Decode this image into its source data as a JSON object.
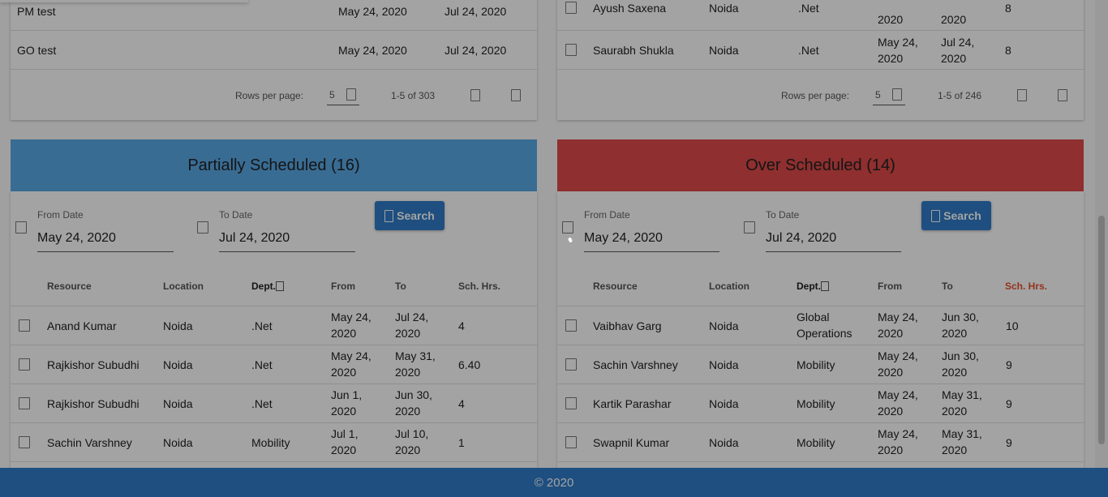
{
  "top_left": {
    "rows": [
      {
        "name": "PM test",
        "from": "May 24, 2020",
        "to": "Jul 24, 2020"
      },
      {
        "name": "GO test",
        "from": "May 24, 2020",
        "to": "Jul 24, 2020"
      }
    ],
    "pager": {
      "rows_label": "Rows per page:",
      "rows_value": "5",
      "range": "1-5 of 303"
    }
  },
  "top_right": {
    "rows": [
      {
        "resource": "Ayush Saxena",
        "location": "Noida",
        "dept": ".Net",
        "from": "2020",
        "to": "2020",
        "hrs": "8"
      },
      {
        "resource": "Saurabh Shukla",
        "location": "Noida",
        "dept": ".Net",
        "from_1": "May 24,",
        "from_2": "2020",
        "to_1": "Jul 24,",
        "to_2": "2020",
        "hrs": "8"
      }
    ],
    "pager": {
      "rows_label": "Rows per page:",
      "rows_value": "5",
      "range": "1-5 of 246"
    }
  },
  "partial": {
    "title": "Partially Scheduled (16)",
    "color": "#5aa9e6",
    "from_label": "From Date",
    "from_value": "May 24, 2020",
    "to_label": "To Date",
    "to_value": "Jul 24, 2020",
    "search_label": "Search",
    "headers": {
      "resource": "Resource",
      "location": "Location",
      "dept": "Dept.",
      "from": "From",
      "to": "To",
      "hrs": "Sch. Hrs."
    },
    "rows": [
      {
        "resource": "Anand Kumar",
        "location": "Noida",
        "dept": ".Net",
        "from_1": "May 24,",
        "from_2": "2020",
        "to_1": "Jul 24,",
        "to_2": "2020",
        "hrs": "4"
      },
      {
        "resource": "Rajkishor Subudhi",
        "location": "Noida",
        "dept": ".Net",
        "from_1": "May 24,",
        "from_2": "2020",
        "to_1": "May 31,",
        "to_2": "2020",
        "hrs": "6.40"
      },
      {
        "resource": "Rajkishor Subudhi",
        "location": "Noida",
        "dept": ".Net",
        "from_1": "Jun 1,",
        "from_2": "2020",
        "to_1": "Jun 30,",
        "to_2": "2020",
        "hrs": "4"
      },
      {
        "resource": "Sachin Varshney",
        "location": "Noida",
        "dept": "Mobility",
        "from_1": "Jul 1,",
        "from_2": "2020",
        "to_1": "Jul 10,",
        "to_2": "2020",
        "hrs": "1"
      }
    ]
  },
  "over": {
    "title": "Over Scheduled (14)",
    "color": "#e04a4a",
    "from_label": "From Date",
    "from_value": "May 24, 2020",
    "to_label": "To Date",
    "to_value": "Jul 24, 2020",
    "search_label": "Search",
    "headers": {
      "resource": "Resource",
      "location": "Location",
      "dept": "Dept.",
      "from": "From",
      "to": "To",
      "hrs": "Sch. Hrs."
    },
    "rows": [
      {
        "resource": "Vaibhav Garg",
        "location": "Noida",
        "dept_1": "Global",
        "dept_2": "Operations",
        "from_1": "May 24,",
        "from_2": "2020",
        "to_1": "Jun 30,",
        "to_2": "2020",
        "hrs": "10"
      },
      {
        "resource": "Sachin Varshney",
        "location": "Noida",
        "dept": "Mobility",
        "from_1": "May 24,",
        "from_2": "2020",
        "to_1": "Jun 30,",
        "to_2": "2020",
        "hrs": "9"
      },
      {
        "resource": "Kartik Parashar",
        "location": "Noida",
        "dept": "Mobility",
        "from_1": "May 24,",
        "from_2": "2020",
        "to_1": "May 31,",
        "to_2": "2020",
        "hrs": "9"
      },
      {
        "resource": "Swapnil Kumar",
        "location": "Noida",
        "dept": "Mobility",
        "from_1": "May 24,",
        "from_2": "2020",
        "to_1": "May 31,",
        "to_2": "2020",
        "hrs": "9"
      }
    ]
  },
  "footer": {
    "text": "© 2020",
    "color": "#2f7cc8"
  }
}
